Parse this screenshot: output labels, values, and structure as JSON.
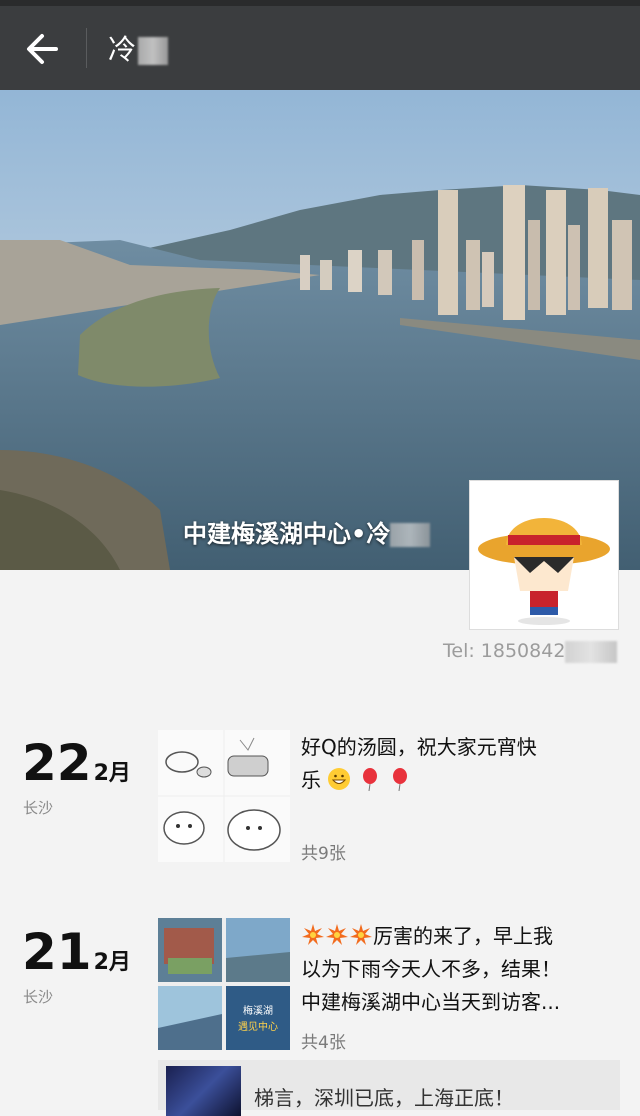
{
  "header": {
    "title": "冷"
  },
  "profile": {
    "cover_caption": "中建梅溪湖中心•冷",
    "tel": "Tel: 1850842"
  },
  "posts": [
    {
      "day": "22",
      "month": "2月",
      "location": "长沙",
      "text_line1": "好Q的汤圆，祝大家元宵快",
      "text_line2": "乐",
      "photo_count": "共9张"
    },
    {
      "day": "21",
      "month": "2月",
      "location": "长沙",
      "text_line1": "厉害的来了，早上我",
      "text_line2": "以为下雨今天人不多，结果！",
      "text_line3": "中建梅溪湖中心当天到访客...",
      "photo_count": "共4张",
      "thumb_label": "梅溪湖",
      "thumb_sub": "遇见中心"
    }
  ],
  "shared_link": {
    "text": "梯言，深圳已底，上海正底！"
  }
}
